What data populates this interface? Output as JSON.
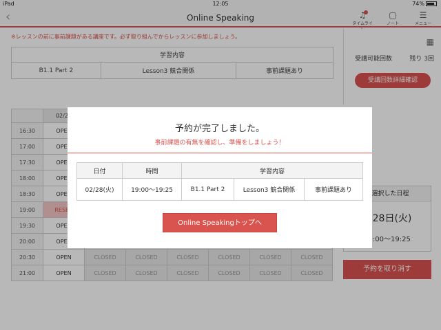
{
  "status": {
    "device": "iPad",
    "time": "12:05",
    "battery": "74%"
  },
  "nav": {
    "back_glyph": "‹",
    "title": "Online Speaking",
    "icons": [
      {
        "name": "bell-icon",
        "label": "タイムライン"
      },
      {
        "name": "note-icon",
        "label": "ノート"
      },
      {
        "name": "menu-icon",
        "label": "メニュー"
      }
    ]
  },
  "notice": "※レッスンの前に事前課題がある講座です。必ず取り組んでからレッスンに参加しましょう。",
  "lesson": {
    "header": "学習内容",
    "cells": [
      "B1.1 Part 2",
      "Lesson3 競合関係",
      "事前課題あり"
    ]
  },
  "remaining": {
    "label": "受講可能回数",
    "value": "残り 3回",
    "detail_button": "受講回数詳細確認"
  },
  "schedule": {
    "date_header": "02/28",
    "rows": [
      {
        "time": "16:30",
        "first": "OPEN"
      },
      {
        "time": "17:00",
        "first": "OPEN"
      },
      {
        "time": "17:30",
        "first": "OPEN"
      },
      {
        "time": "18:00",
        "first": "OPEN"
      },
      {
        "time": "18:30",
        "first": "OPEN"
      },
      {
        "time": "19:00",
        "first": "RESER"
      },
      {
        "time": "19:30",
        "first": "OPEN"
      },
      {
        "time": "20:00",
        "first": "OPEN"
      },
      {
        "time": "20:30",
        "first": "OPEN",
        "closed": [
          "CLOSED",
          "CLOSED",
          "CLOSED",
          "CLOSED",
          "CLOSED",
          "CLOSED"
        ]
      },
      {
        "time": "21:00",
        "first": "OPEN",
        "closed": [
          "CLOSED",
          "CLOSED",
          "CLOSED",
          "CLOSED",
          "CLOSED",
          "CLOSED"
        ]
      }
    ]
  },
  "selected": {
    "header": "が選択した日程",
    "date": "月28日(火)",
    "time": "19:00～19:25",
    "cancel_button": "予約を取り消す"
  },
  "modal": {
    "title": "予約が完了しました。",
    "subtitle": "事前課題の有無を確認し、準備をしましょう！",
    "headers": {
      "date": "日付",
      "time": "時間",
      "content": "学習内容"
    },
    "values": {
      "date": "02/28(火)",
      "time": "19:00～19:25",
      "course": "B1.1 Part 2",
      "lesson": "Lesson3 競合関係",
      "task": "事前課題あり"
    },
    "button": "Online Speakingトップへ"
  },
  "colors": {
    "accent": "#d9534f"
  }
}
